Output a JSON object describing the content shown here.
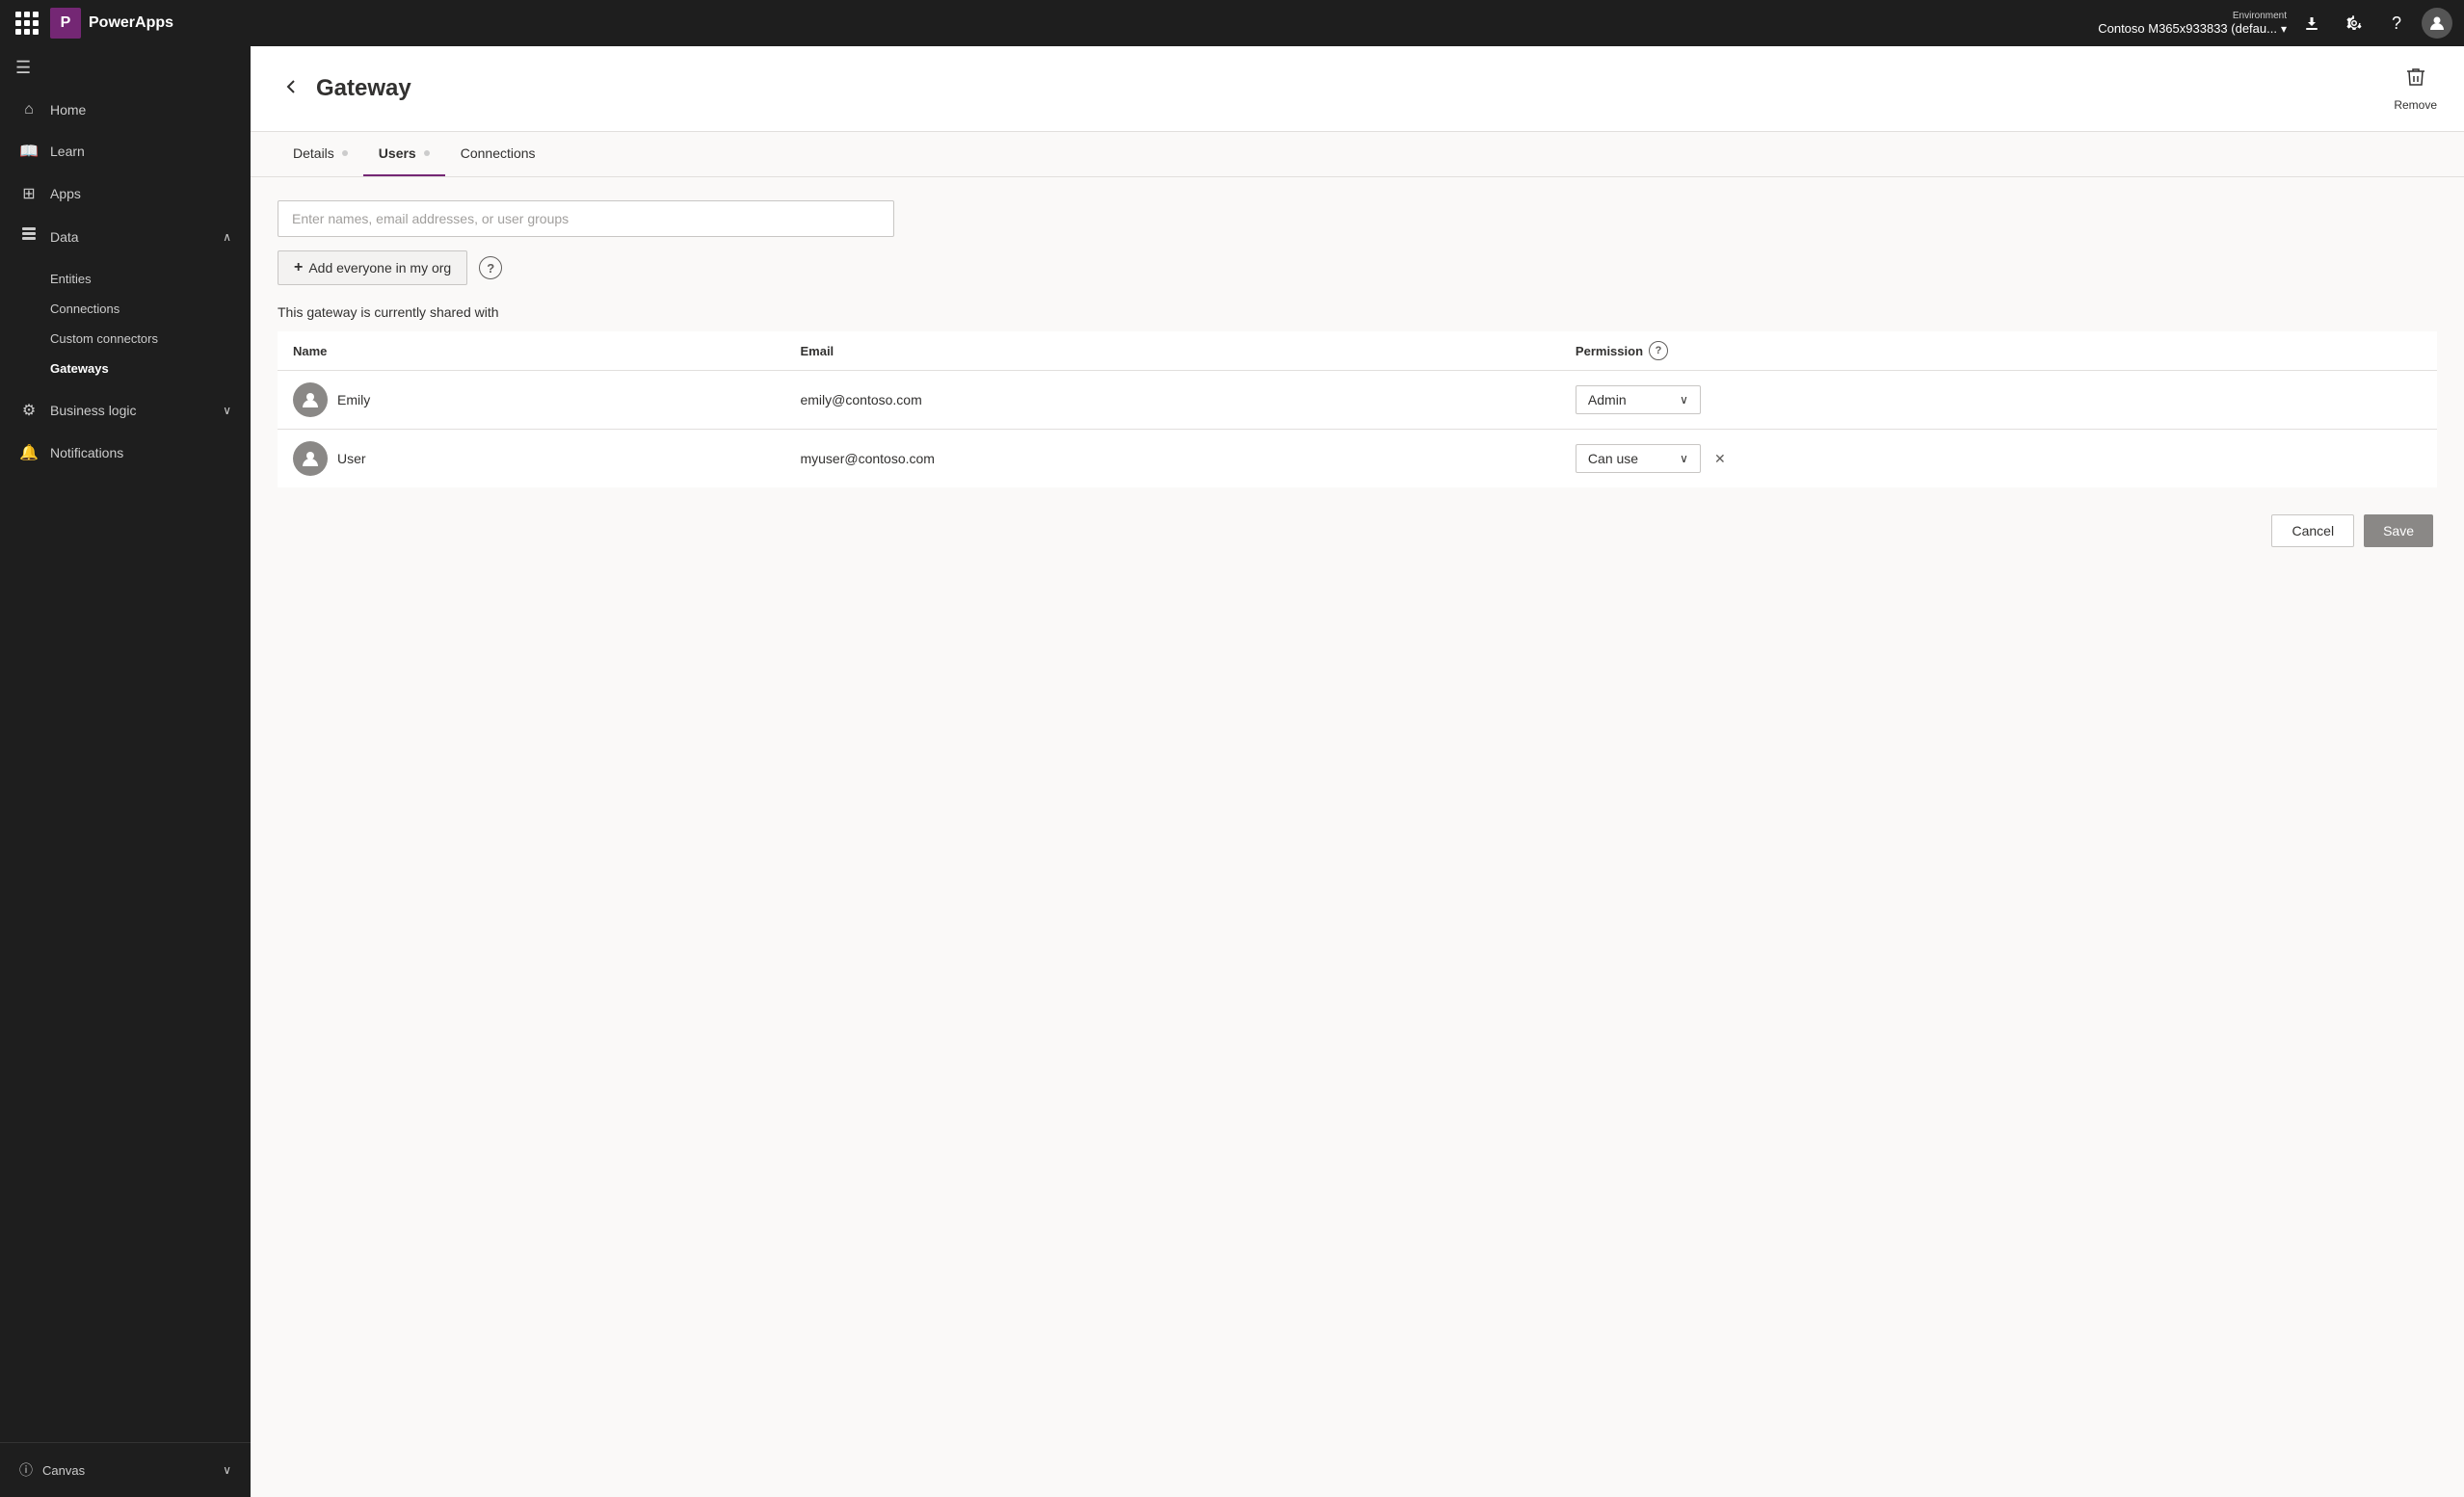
{
  "topNav": {
    "brandInitial": "P",
    "brandName": "PowerApps",
    "envLabel": "Environment",
    "envName": "Contoso M365x933833 (defau...",
    "chevronDown": "▾"
  },
  "sidebar": {
    "menuIcon": "☰",
    "items": [
      {
        "id": "home",
        "label": "Home",
        "icon": "⌂"
      },
      {
        "id": "learn",
        "label": "Learn",
        "icon": "📖"
      },
      {
        "id": "apps",
        "label": "Apps",
        "icon": "⊞"
      },
      {
        "id": "data",
        "label": "Data",
        "icon": "⊟",
        "expandable": true,
        "expanded": true
      },
      {
        "id": "business-logic",
        "label": "Business logic",
        "icon": "⚙",
        "expandable": true
      },
      {
        "id": "notifications",
        "label": "Notifications",
        "icon": "🔔"
      }
    ],
    "dataSubItems": [
      {
        "id": "entities",
        "label": "Entities"
      },
      {
        "id": "connections",
        "label": "Connections"
      },
      {
        "id": "custom-connectors",
        "label": "Custom connectors"
      },
      {
        "id": "gateways",
        "label": "Gateways",
        "active": true
      }
    ],
    "bottomItems": [
      {
        "id": "canvas",
        "label": "Canvas",
        "expandable": true
      }
    ]
  },
  "page": {
    "title": "Gateway",
    "removeLabel": "Remove",
    "tabs": [
      {
        "id": "details",
        "label": "Details",
        "hasDot": true
      },
      {
        "id": "users",
        "label": "Users",
        "hasDot": true,
        "active": true
      },
      {
        "id": "connections",
        "label": "Connections",
        "hasDot": false
      }
    ],
    "searchPlaceholder": "Enter names, email addresses, or user groups",
    "addEveryoneLabel": "Add everyone in my org",
    "sharedWithText": "This gateway is currently shared with",
    "tableColumns": {
      "name": "Name",
      "email": "Email",
      "permission": "Permission"
    },
    "users": [
      {
        "id": "emily",
        "name": "Emily",
        "email": "emily@contoso.com",
        "permission": "Admin",
        "canRemove": false
      },
      {
        "id": "user",
        "name": "User",
        "email": "myuser@contoso.com",
        "permission": "Can use",
        "canRemove": true
      }
    ],
    "cancelLabel": "Cancel",
    "saveLabel": "Save"
  }
}
